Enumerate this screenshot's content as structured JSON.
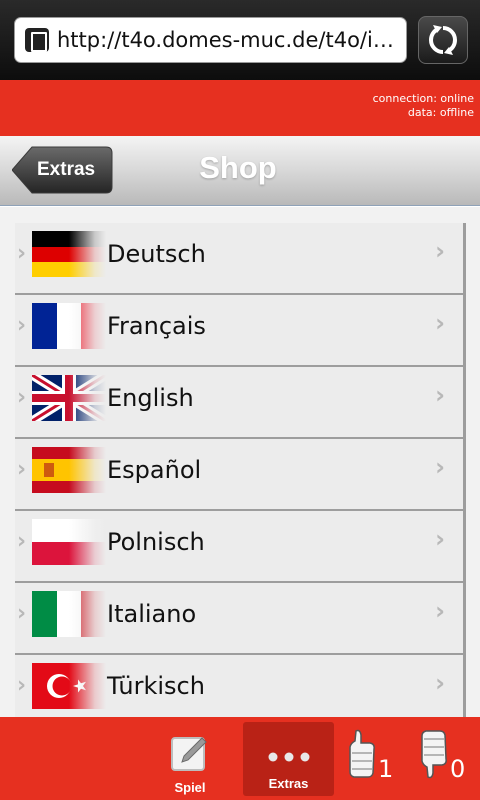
{
  "browser": {
    "url": "http://t4o.domes-muc.de/t4o/in..."
  },
  "status": {
    "connection": "connection: online",
    "data": "data: offline"
  },
  "header": {
    "back_label": "Extras",
    "title": "Shop"
  },
  "languages": [
    {
      "label": "Deutsch",
      "flag": "germany-flag-icon"
    },
    {
      "label": "Français",
      "flag": "france-flag-icon"
    },
    {
      "label": "English",
      "flag": "uk-flag-icon"
    },
    {
      "label": "Español",
      "flag": "spain-flag-icon"
    },
    {
      "label": "Polnisch",
      "flag": "poland-flag-icon"
    },
    {
      "label": "Italiano",
      "flag": "italy-flag-icon"
    },
    {
      "label": "Türkisch",
      "flag": "turkey-flag-icon"
    }
  ],
  "tabbar": {
    "spiel_label": "Spiel",
    "extras_label": "Extras",
    "thumbs_up_count": "1",
    "thumbs_down_count": "0"
  },
  "colors": {
    "accent_red": "#e63020",
    "active_tab": "#b92216"
  }
}
